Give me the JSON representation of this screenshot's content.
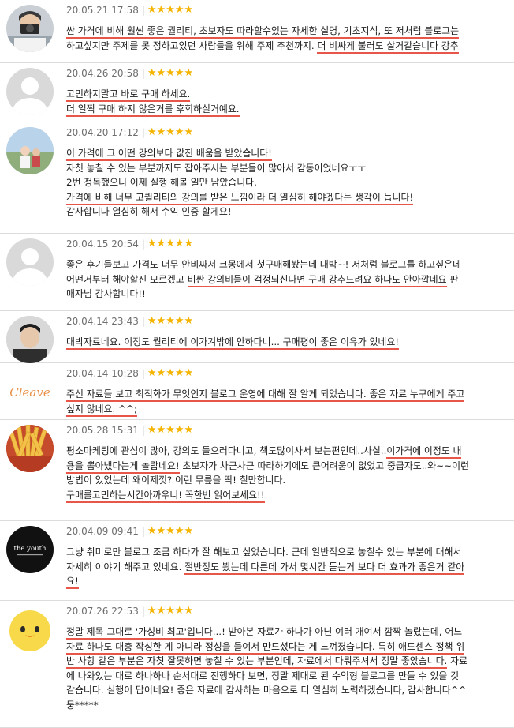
{
  "accent": {
    "underline": "#e8564a",
    "star": "#f5b400"
  },
  "reviews": [
    {
      "date": "20.05.21 17:58",
      "rating": 5,
      "avatar": "user-photo-camera",
      "lines": [
        [
          {
            "t": "싼 가격에 비해 훨씬 좋은 퀄리티, 초보자도 따라할수있는 자세한 설명, 기초지식, 또 저처럼 블로그는",
            "u": true
          }
        ],
        [
          {
            "t": "하고싶지만 주제를 못 정하고있던 사람들을 위해 주제 추천까지. ",
            "u": false
          },
          {
            "t": "더 비싸게 불러도 살거같습니다 강추",
            "u": true
          }
        ]
      ]
    },
    {
      "date": "20.04.26 20:58",
      "rating": 5,
      "avatar": "default-profile",
      "lines": [
        [
          {
            "t": "고민하지말고 바로 구매 하세요.",
            "u": true
          }
        ],
        [
          {
            "t": "더 일찍 구매 하지 않은거를 후회하실거예요.",
            "u": true
          }
        ]
      ]
    },
    {
      "date": "20.04.20 17:12",
      "rating": 5,
      "avatar": "user-photo-outdoor",
      "lines": [
        [
          {
            "t": "이 가격에 그 어떤 강의보다 값진 배움을 받았습니다!",
            "u": true
          }
        ],
        [
          {
            "t": "자칫 놓칠 수 있는 부분까지도 잡아주시는 부분들이 많아서 감동이었네요ㅜㅜ",
            "u": false
          }
        ],
        [
          {
            "t": "2번 정독했으니 이제 실행 해볼 일만 남았습니다.",
            "u": false
          }
        ],
        [
          {
            "t": "가격에 비해 너무 고퀄리티의 강의를 받은 느낌이라 더 열심히 해야겠다는 생각이 듭니다!",
            "u": true
          }
        ],
        [
          {
            "t": "감사합니다 열심히 해서 수익 인증 할게요!",
            "u": false
          }
        ]
      ]
    },
    {
      "date": "20.04.15 20:54",
      "rating": 5,
      "avatar": "default-profile",
      "lines": [
        [
          {
            "t": "좋은 후기들보고 가격도 너무 안비싸서 크몽에서 첫구매해봤는데 대박~! 저처럼 블로그를 하고싶은데",
            "u": false
          }
        ],
        [
          {
            "t": "어떤거부터 해야할진 모르겠고 ",
            "u": false
          },
          {
            "t": "비싼 강의비들이 걱정되신다면 구매 강추드려요 하나도 안아깝네요",
            "u": true
          },
          {
            "t": " 판",
            "u": false
          }
        ],
        [
          {
            "t": "매자님 감사합니다!!",
            "u": false
          }
        ]
      ]
    },
    {
      "date": "20.04.14 23:43",
      "rating": 5,
      "avatar": "user-photo-man",
      "lines": [
        [
          {
            "t": "대박자료네요. 이정도 퀄리티에 이가겨밖에 안하다니... 구매평이 좋은 이유가 있네요!",
            "u": true
          }
        ]
      ]
    },
    {
      "date": "20.04.14 10:28",
      "rating": 5,
      "avatar": "cleave-logo",
      "lines": [
        [
          {
            "t": "주신 자료들 보고 최적화가 무엇인지 블로그 운영에 대해 잘 알게 되었습니다. ",
            "u": true
          },
          {
            "t": "좋은 자료 누구에게 주고",
            "u": true
          }
        ],
        [
          {
            "t": "싶지 않네요. ^^;",
            "u": true
          }
        ]
      ]
    },
    {
      "date": "20.05.28 15:31",
      "rating": 5,
      "avatar": "fries-photo",
      "lines": [
        [
          {
            "t": "평소마케팅에 관심이 많아, 강의도 들으러다니고, 책도많이사서 보는편인데..사실..",
            "u": false
          },
          {
            "t": "이가격에 이정도 내",
            "u": true
          }
        ],
        [
          {
            "t": "용을 뽑아냈다는게 놀랍네요!",
            "u": true
          },
          {
            "t": " 초보자가 차근차근 따라하기에도 큰어려움이 없었고 중급자도..와~~이런",
            "u": false
          }
        ],
        [
          {
            "t": "방법이 있었는데 왜이제껏? 이런 무릎을 딱! 칠만합니다.",
            "u": false
          }
        ],
        [
          {
            "t": "구매를고민하는시간아까우니! 꼭한번 읽어보세요!!",
            "u": true
          }
        ]
      ]
    },
    {
      "date": "20.04.09 09:41",
      "rating": 5,
      "avatar": "the-youth-logo",
      "avatar_text": "the youth",
      "lines": [
        [
          {
            "t": "그냥 취미로만 블로그 조금 하다가 잘 해보고 싶었습니다. 근데 일반적으로 놓칠수 있는 부분에 대해서",
            "u": false
          }
        ],
        [
          {
            "t": "자세히 이야기 해주고 있네요. ",
            "u": false
          },
          {
            "t": "절반정도 봤는데 다른데 가서 몇시간 듣는거 보다 더 효과가 좋은거 같아",
            "u": true
          }
        ],
        [
          {
            "t": "요!",
            "u": true
          }
        ]
      ]
    },
    {
      "date": "20.07.26 22:53",
      "rating": 5,
      "avatar": "chick-character",
      "lines": [
        [
          {
            "t": "정말 제목 그대로 '가성비 최고'입니다",
            "u": true
          },
          {
            "t": "...! 받아본 자료가 하나가 아닌 여러 개여서 깜짝 놀랐는데, 어느",
            "u": false
          }
        ],
        [
          {
            "t": "자료 하나도 대충 작성한 게 아니라 정성을 들여서 만드셨다는 게 느껴졌습니다.",
            "u": true
          },
          {
            "t": " 특히 애드센스 정책 위",
            "u": true
          }
        ],
        [
          {
            "t": "반 사항 같은 부분은 자칫 잘못하면 놓칠 수 있는 부분인데, 자료에서 다뤄주셔서 정말 좋았습니다.",
            "u": true
          },
          {
            "t": " 자료",
            "u": false
          }
        ],
        [
          {
            "t": "에 나와있는 대로 하나하나 순서대로 진행하다 보면, 정말 제대로 된 수익형 블로그를 만들 수 있을 것",
            "u": false
          }
        ],
        [
          {
            "t": "같습니다. 실행이 답이네요! 좋은 자료에 감사하는 마음으로 더 열심히 노력하겠습니다, 감사합니다^^",
            "u": false
          }
        ],
        [
          {
            "t": "뭉*****",
            "u": false
          }
        ]
      ]
    }
  ]
}
